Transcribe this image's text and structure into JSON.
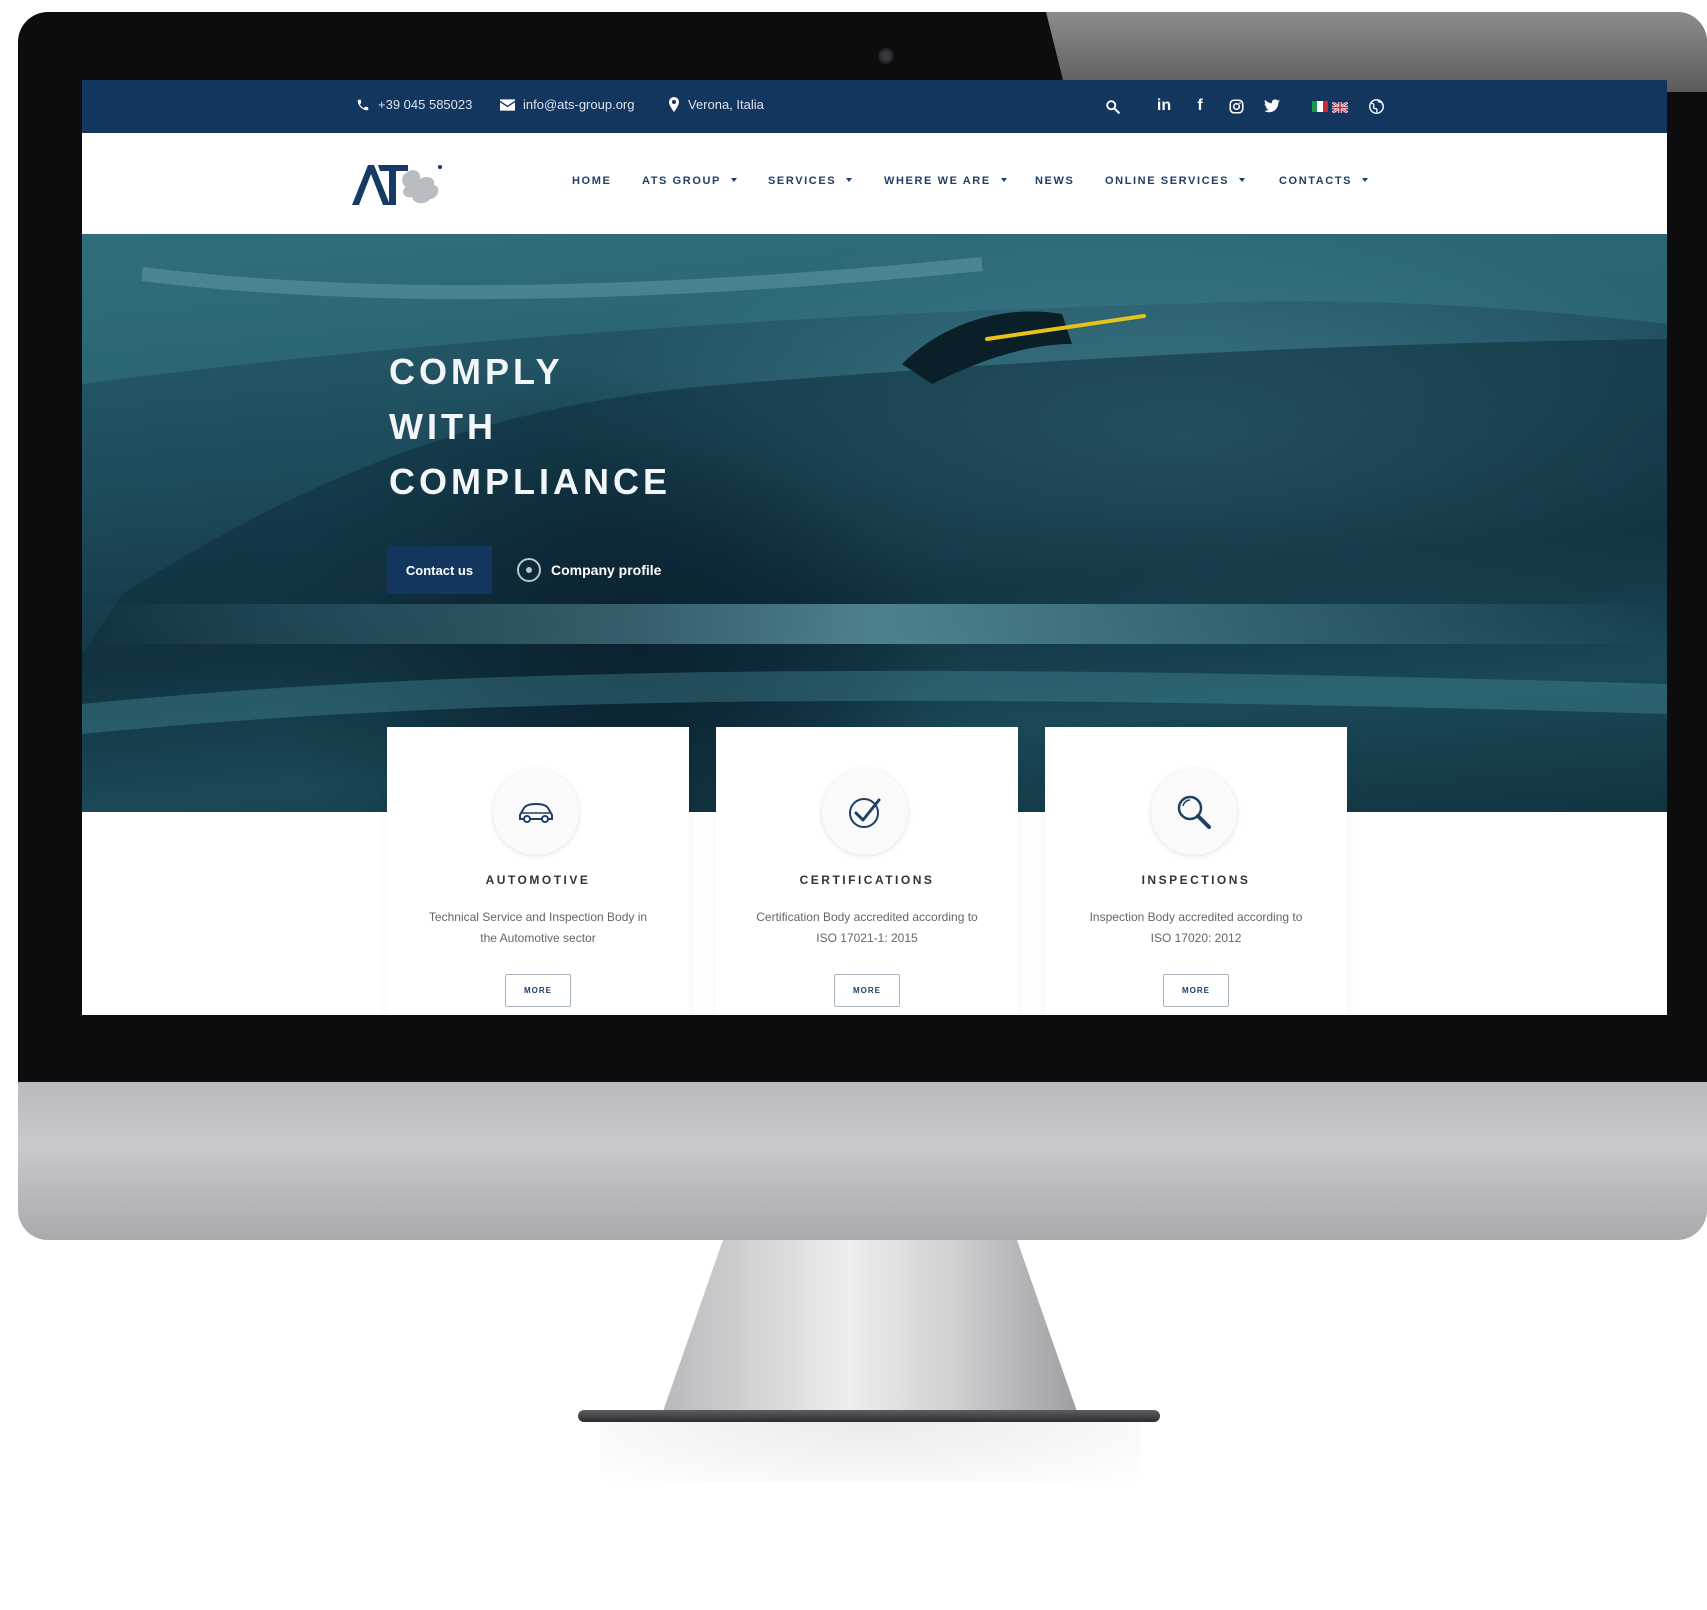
{
  "topbar": {
    "phone": "+39 045 585023",
    "email": "info@ats-group.org",
    "location": "Verona, Italia",
    "social": {
      "linkedin": "in",
      "facebook": "f"
    }
  },
  "nav": {
    "items": [
      {
        "label": "HOME",
        "dropdown": false
      },
      {
        "label": "ATS GROUP",
        "dropdown": true
      },
      {
        "label": "SERVICES",
        "dropdown": true
      },
      {
        "label": "WHERE WE ARE",
        "dropdown": true
      },
      {
        "label": "NEWS",
        "dropdown": false
      },
      {
        "label": "ONLINE SERVICES",
        "dropdown": true
      },
      {
        "label": "CONTACTS",
        "dropdown": true
      }
    ]
  },
  "hero": {
    "title_lines": [
      "COMPLY",
      "WITH",
      "COMPLIANCE"
    ],
    "contact_button": "Contact us",
    "profile_link": "Company profile"
  },
  "cards": [
    {
      "icon": "car-icon",
      "title": "AUTOMOTIVE",
      "description": "Technical Service and Inspection Body in the Automotive sector",
      "button": "MORE"
    },
    {
      "icon": "check-badge-icon",
      "title": "CERTIFICATIONS",
      "description": "Certification Body accredited according to ISO 17021-1: 2015",
      "button": "MORE"
    },
    {
      "icon": "magnifier-icon",
      "title": "INSPECTIONS",
      "description": "Inspection Body accredited according to ISO 17020: 2012",
      "button": "MORE"
    }
  ],
  "colors": {
    "brand_navy": "#13365f",
    "nav_text": "#1f3f66",
    "hero_teal": "#1d4c5c",
    "accent_yellow": "#e8c21a"
  }
}
